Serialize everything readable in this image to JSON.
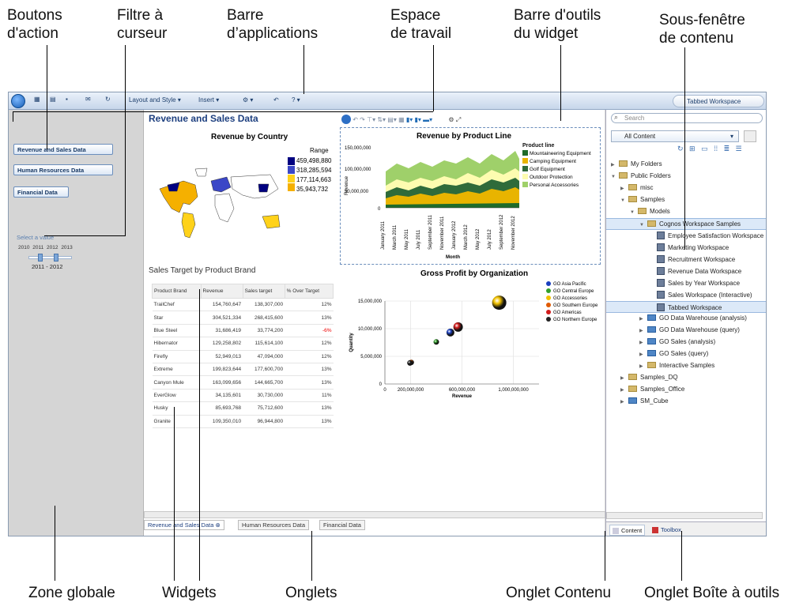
{
  "callouts": {
    "boutons": "Boutons\nd'action",
    "filtre": "Filtre à\ncurseur",
    "barre_app": "Barre\nd’applications",
    "espace": "Espace\nde travail",
    "barre_widget": "Barre d'outils\ndu widget",
    "sous_fenetre": "Sous-fenêtre\nde contenu",
    "zone": "Zone globale",
    "widgets": "Widgets",
    "onglets": "Onglets",
    "onglet_contenu": "Onglet Contenu",
    "onglet_boite": "Onglet Boîte à outils"
  },
  "toolbar": {
    "layout": "Layout and Style ▾",
    "insert": "Insert ▾",
    "tabbed": "Tabbed Workspace"
  },
  "global": {
    "buttons": [
      "Revenue and Sales Data",
      "Human Resources Data",
      "Financial Data"
    ],
    "slider_label": "Select a value",
    "years": "2010 2011 2012 2013",
    "range": "2011 - 2012"
  },
  "workspace": {
    "title": "Revenue and Sales Data"
  },
  "map": {
    "title": "Revenue by Country",
    "legend_title": "Range",
    "legend": [
      "459,498,880",
      "318,285,594",
      "177,114,663",
      "35,943,732"
    ],
    "colors": [
      "#000080",
      "#3b47c7",
      "#ffd21a",
      "#f5b000"
    ]
  },
  "area_chart": {
    "title": "Revenue by Product Line",
    "ylabel": "Revenue",
    "xlabel": "Month",
    "legend_title": "Product line",
    "legend": [
      "Mountaineering Equipment",
      "Camping Equipment",
      "Golf Equipment",
      "Outdoor Protection",
      "Personal Accessories"
    ],
    "colors": [
      "#1f6b2a",
      "#e8b400",
      "#2f6b3a",
      "#fdfcb0",
      "#9fd06a"
    ],
    "y_ticks": [
      "150,000,000",
      "100,000,000",
      "50,000,000",
      "0"
    ],
    "x_ticks": [
      "January 2011",
      "March 2011",
      "May 2011",
      "July 2011",
      "September 2011",
      "November 2011",
      "January 2012",
      "March 2012",
      "May 2012",
      "July 2012",
      "September 2012",
      "November 2012"
    ]
  },
  "table": {
    "title": "Sales Target by Product Brand",
    "columns": [
      "Product Brand",
      "Revenue",
      "Sales target",
      "% Over Target"
    ],
    "rows": [
      [
        "TrailChef",
        "154,760,647",
        "138,307,000",
        "12%"
      ],
      [
        "Star",
        "304,521,334",
        "268,415,600",
        "13%"
      ],
      [
        "Blue Steel",
        "31,686,419",
        "33,774,200",
        "-6%"
      ],
      [
        "Hibernator",
        "129,258,802",
        "115,614,100",
        "12%"
      ],
      [
        "Firefly",
        "52,949,013",
        "47,094,000",
        "12%"
      ],
      [
        "Extreme",
        "199,823,644",
        "177,600,700",
        "13%"
      ],
      [
        "Canyon Mule",
        "163,099,656",
        "144,665,700",
        "13%"
      ],
      [
        "EverGlow",
        "34,135,601",
        "30,730,000",
        "11%"
      ],
      [
        "Husky",
        "85,693,768",
        "75,712,600",
        "13%"
      ],
      [
        "Granite",
        "109,350,010",
        "96,944,800",
        "13%"
      ]
    ]
  },
  "chart_data": {
    "type": "scatter",
    "title": "Gross Profit by Organization",
    "xlabel": "Revenue",
    "ylabel": "Quantity",
    "xlim": [
      0,
      1200000000
    ],
    "ylim": [
      0,
      15000000
    ],
    "x_ticks": [
      "0",
      "200,000,000",
      "600,000,000",
      "1,000,000,000"
    ],
    "y_ticks": [
      "15,000,000",
      "10,000,000",
      "5,000,000",
      "0"
    ],
    "series": [
      {
        "name": "GO Asia Pacific",
        "x": [
          510000000
        ],
        "y": [
          9300000
        ],
        "color": "#1a3fbf"
      },
      {
        "name": "GO Central Europe",
        "x": [
          400000000
        ],
        "y": [
          7600000
        ],
        "color": "#33a02c"
      },
      {
        "name": "GO Accessories",
        "x": [
          890000000
        ],
        "y": [
          14700000
        ],
        "color": "#f2c200"
      },
      {
        "name": "GO Southern Europe",
        "x": [
          205000000
        ],
        "y": [
          3900000
        ],
        "color": "#e05a00"
      },
      {
        "name": "GO Americas",
        "x": [
          570000000
        ],
        "y": [
          10300000
        ],
        "color": "#d11c1c"
      },
      {
        "name": "GO Northern Europe",
        "x": [
          195000000
        ],
        "y": [
          3800000
        ],
        "color": "#222222"
      }
    ]
  },
  "tabs": [
    "Revenue and Sales Data",
    "Human Resources Data",
    "Financial Data"
  ],
  "content": {
    "search_placeholder": "Search",
    "combo": "All Content",
    "tree": [
      {
        "label": "My Folders",
        "level": 0,
        "icon": "folder-user"
      },
      {
        "label": "Public Folders",
        "level": 0,
        "icon": "folder-public",
        "open": true
      },
      {
        "label": "misc",
        "level": 1,
        "icon": "folder"
      },
      {
        "label": "Samples",
        "level": 1,
        "icon": "folder",
        "open": true
      },
      {
        "label": "Models",
        "level": 2,
        "icon": "folder",
        "open": true
      },
      {
        "label": "Cognos Workspace Samples",
        "level": 3,
        "icon": "folder",
        "open": true,
        "selected": true
      },
      {
        "label": "Employee Satisfaction Workspace",
        "level": 4,
        "icon": "workspace"
      },
      {
        "label": "Marketing Workspace",
        "level": 4,
        "icon": "workspace"
      },
      {
        "label": "Recruitment Workspace",
        "level": 4,
        "icon": "workspace"
      },
      {
        "label": "Revenue Data Workspace",
        "level": 4,
        "icon": "workspace"
      },
      {
        "label": "Sales by Year Workspace",
        "level": 4,
        "icon": "workspace"
      },
      {
        "label": "Sales Workspace (Interactive)",
        "level": 4,
        "icon": "workspace"
      },
      {
        "label": "Tabbed Workspace",
        "level": 4,
        "icon": "workspace",
        "selected": true
      },
      {
        "label": "GO Data Warehouse (analysis)",
        "level": 3,
        "icon": "package"
      },
      {
        "label": "GO Data Warehouse (query)",
        "level": 3,
        "icon": "package"
      },
      {
        "label": "GO Sales (analysis)",
        "level": 3,
        "icon": "package"
      },
      {
        "label": "GO Sales (query)",
        "level": 3,
        "icon": "package"
      },
      {
        "label": "Interactive Samples",
        "level": 3,
        "icon": "folder"
      },
      {
        "label": "Samples_DQ",
        "level": 1,
        "icon": "folder"
      },
      {
        "label": "Samples_Office",
        "level": 1,
        "icon": "folder"
      },
      {
        "label": "SM_Cube",
        "level": 1,
        "icon": "cube"
      }
    ],
    "tab_content": "Content",
    "tab_toolbox": "Toolbox"
  }
}
